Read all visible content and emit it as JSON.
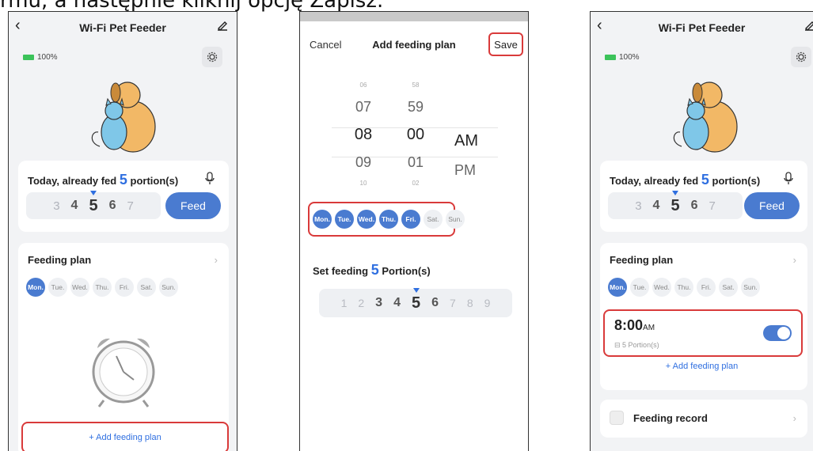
{
  "caption": "rmu, a następnie kliknij opcję Zapisz.",
  "p1": {
    "title": "Wi-Fi Pet Feeder",
    "battery": "100%",
    "fed_prefix": "Today, already fed",
    "fed_num": "5",
    "fed_suffix": "portion(s)",
    "picker": [
      "3",
      "4",
      "5",
      "6",
      "7"
    ],
    "feed": "Feed",
    "plan_title": "Feeding plan",
    "days": [
      "Mon.",
      "Tue.",
      "Wed.",
      "Thu.",
      "Fri.",
      "Sat.",
      "Sun."
    ],
    "add_plan": "+ Add feeding plan"
  },
  "p2": {
    "cancel": "Cancel",
    "title": "Add feeding plan",
    "save": "Save",
    "hours": [
      "06",
      "07",
      "08",
      "09",
      "10"
    ],
    "minutes": [
      "58",
      "59",
      "00",
      "01",
      "02"
    ],
    "am": "AM",
    "pm": "PM",
    "days": [
      "Mon.",
      "Tue.",
      "Wed.",
      "Thu.",
      "Fri.",
      "Sat.",
      "Sun."
    ],
    "set_prefix": "Set feeding",
    "set_num": "5",
    "set_suffix": "Portion(s)",
    "picker": [
      "1",
      "2",
      "3",
      "4",
      "5",
      "6",
      "7",
      "8",
      "9"
    ]
  },
  "p3": {
    "title": "Wi-Fi Pet Feeder",
    "battery": "100%",
    "fed_prefix": "Today, already fed",
    "fed_num": "5",
    "fed_suffix": "portion(s)",
    "picker": [
      "3",
      "4",
      "5",
      "6",
      "7"
    ],
    "feed": "Feed",
    "plan_title": "Feeding plan",
    "days": [
      "Mon.",
      "Tue.",
      "Wed.",
      "Thu.",
      "Fri.",
      "Sat.",
      "Sun."
    ],
    "plan_time": "8:00",
    "plan_ampm": "AM",
    "plan_portions": "5 Portion(s)",
    "add_plan": "+ Add feeding plan",
    "record": "Feeding record"
  },
  "colors": {
    "accent": "#4a7bd0",
    "highlight": "#d93a3a"
  }
}
